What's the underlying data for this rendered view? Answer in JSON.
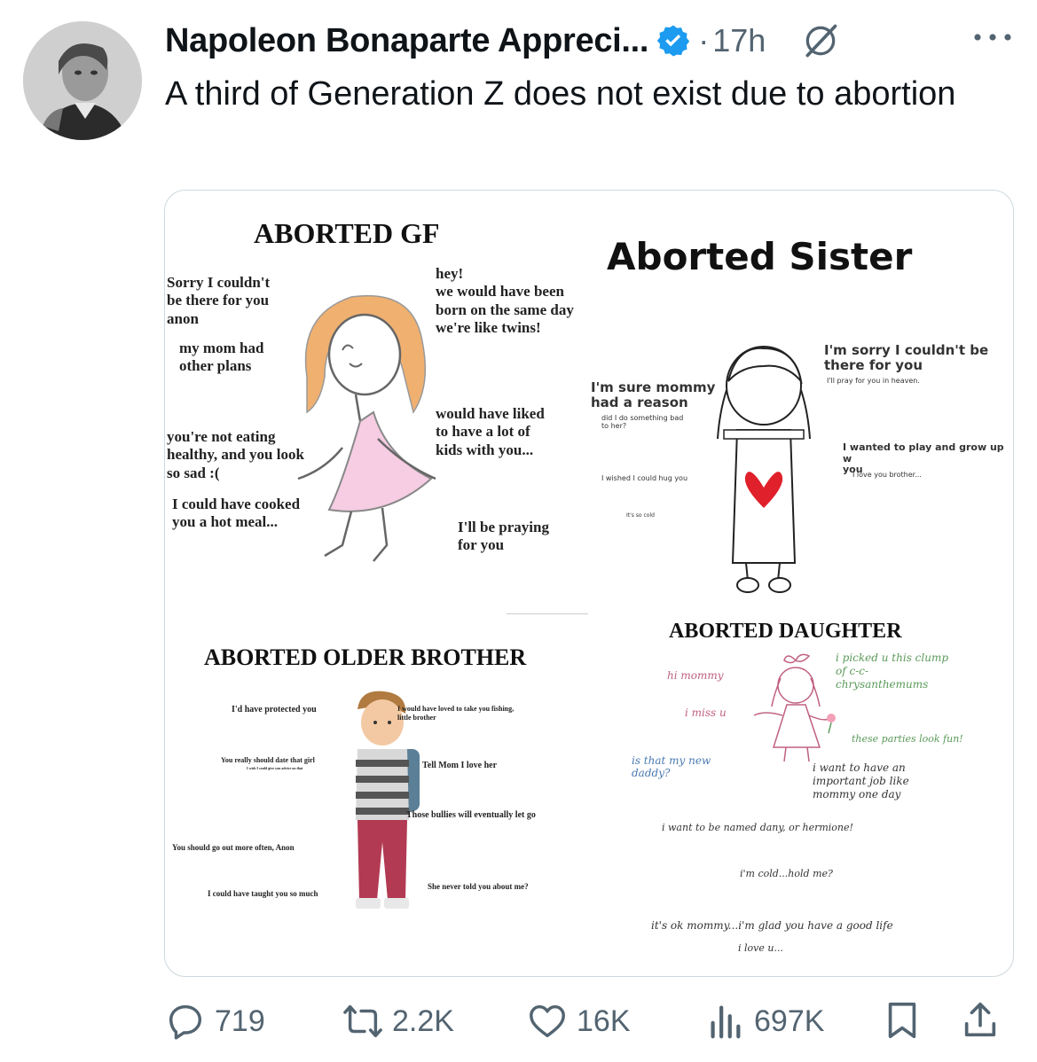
{
  "tweet": {
    "author": "Napoleon Bonaparte Appreci...",
    "separator": "·",
    "time": "17h",
    "text": "A third of Generation Z does not exist due to abortion"
  },
  "media": {
    "gf": {
      "title": "ABORTED GF",
      "quotes": [
        "Sorry I couldn't\nbe there for you\nanon",
        "my mom had\nother plans",
        "you're not eating\nhealthy, and you look\nso sad :(",
        "I could have cooked\nyou a hot meal...",
        "hey!\nwe would have been\nborn on the same day\nwe're like twins!",
        "would have liked\nto have a lot of\nkids with you...",
        "I'll be praying\nfor you"
      ]
    },
    "sister": {
      "title": "Aborted Sister",
      "quotes": [
        "I'm sorry I couldn't be\nthere for you",
        "I'll pray for you in heaven.",
        "I'm sure mommy\nhad a reason",
        "did I do something bad\nto her?",
        "I wanted to play and grow up w\nyou",
        "I love you brother...",
        "I wished I could hug you",
        "It's so cold"
      ]
    },
    "brother": {
      "title": "ABORTED OLDER BROTHER",
      "quotes": [
        "I'd have protected you",
        "I would have loved to take you fishing,\nlittle brother",
        "You really should date that girl",
        "I wish I could give you advice on that",
        "Tell Mom I love her",
        "Those bullies will eventually let go",
        "You should go out more often, Anon",
        "I could have taught you so much",
        "She never told you about me?"
      ]
    },
    "daughter": {
      "title": "ABORTED DAUGHTER",
      "quotes": [
        "hi mommy",
        "i miss u",
        "i picked u this clump\nof c-c-\nchrysanthemums",
        "these parties look fun!",
        "is that my new\ndaddy?",
        "i want to have an\nimportant job like\nmommy one day",
        "i want to be named dany, or hermione!",
        "i'm cold...hold me?",
        "it's ok mommy...i'm glad you have a good life",
        "i love u..."
      ]
    }
  },
  "actions": {
    "replies": "719",
    "reposts": "2.2K",
    "likes": "16K",
    "views": "697K"
  },
  "colors": {
    "verified": "#1d9bf0",
    "secondary_text": "#536471",
    "daughter_green": "#5a9a5a",
    "daughter_pink": "#c06080",
    "heart_red": "#e0202a"
  }
}
